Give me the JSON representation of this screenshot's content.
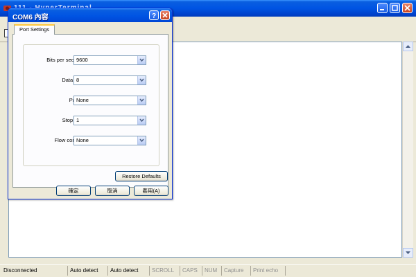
{
  "main_window": {
    "title": "111 - HyperTerminal"
  },
  "dialog": {
    "title": "COM6 內容",
    "tab_label": "Port Settings",
    "fields": [
      {
        "label": "Bits per second:",
        "value": "9600"
      },
      {
        "label": "Data bits:",
        "value": "8"
      },
      {
        "label": "Parity:",
        "value": "None"
      },
      {
        "label": "Stop bits:",
        "value": "1"
      },
      {
        "label": "Flow control:",
        "value": "None"
      }
    ],
    "restore_defaults_label": "Restore Defaults",
    "ok_label": "確定",
    "cancel_label": "取消",
    "apply_label": "套用(A)"
  },
  "statusbar": {
    "connection": "Disconnected",
    "detect1": "Auto detect",
    "detect2": "Auto detect",
    "scroll": "SCROLL",
    "caps": "CAPS",
    "num": "NUM",
    "capture": "Capture",
    "print_echo": "Print echo"
  },
  "colors": {
    "titlebar_blue": "#0054e3",
    "window_face": "#ece9d8",
    "tab_highlight": "#ffc83c",
    "close_red": "#c74520"
  }
}
